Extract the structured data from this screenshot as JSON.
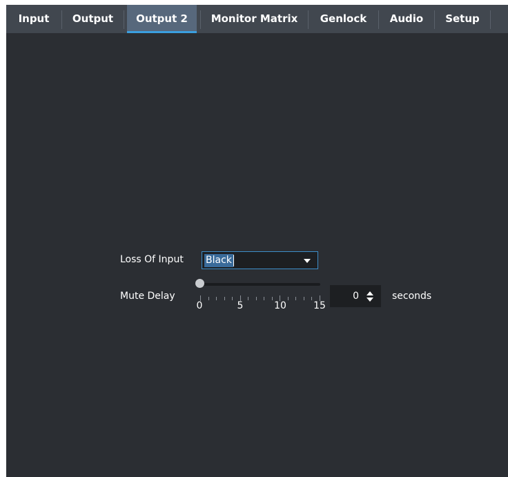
{
  "tabs": [
    {
      "label": "Input",
      "active": false
    },
    {
      "label": "Output",
      "active": false
    },
    {
      "label": "Output 2",
      "active": true
    },
    {
      "label": "Monitor Matrix",
      "active": false
    },
    {
      "label": "Genlock",
      "active": false
    },
    {
      "label": "Audio",
      "active": false
    },
    {
      "label": "Setup",
      "active": false
    }
  ],
  "loss_of_input": {
    "label": "Loss Of Input",
    "selected": "Black"
  },
  "mute_delay": {
    "label": "Mute Delay",
    "slider_value": 0,
    "slider_min": 0,
    "slider_max": 15,
    "tick_labels": [
      "0",
      "5",
      "10",
      "15"
    ],
    "spin_value": "0",
    "unit": "seconds"
  },
  "colors": {
    "background": "#2b2e33",
    "tabbar": "#41474f",
    "active_tab": "#57687c",
    "accent": "#3b9fe0"
  }
}
